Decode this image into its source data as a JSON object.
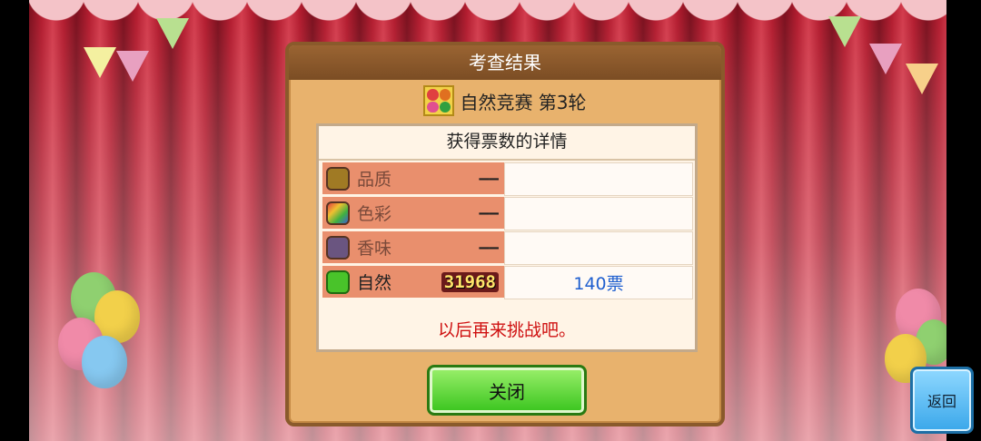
{
  "dialog": {
    "title": "考查结果",
    "contest_name": "自然竞赛 第3轮",
    "panel_heading": "获得票数的详情",
    "rows": [
      {
        "label": "品质",
        "score": "——",
        "votes": "",
        "icon": "quality-icon",
        "color": "#8a6a1c",
        "active": false
      },
      {
        "label": "色彩",
        "score": "——",
        "votes": "",
        "icon": "color-icon",
        "color": "#5a7ad0",
        "active": false
      },
      {
        "label": "香味",
        "score": "——",
        "votes": "",
        "icon": "aroma-icon",
        "color": "#6a5580",
        "active": false
      },
      {
        "label": "自然",
        "score": "31968",
        "votes": "140票",
        "icon": "nature-icon",
        "color": "#49c32a",
        "active": true
      }
    ],
    "message": "以后再来挑战吧。",
    "close_label": "关闭"
  },
  "back_label": "返回",
  "colors": {
    "curtain": "#b21a2d",
    "dialog_bg": "#e8b26d",
    "row_bg": "#e98f6d",
    "message": "#cf1111",
    "votes": "#1f5fcf",
    "close_button": "#38c41d",
    "back_button": "#3aa7ea"
  }
}
